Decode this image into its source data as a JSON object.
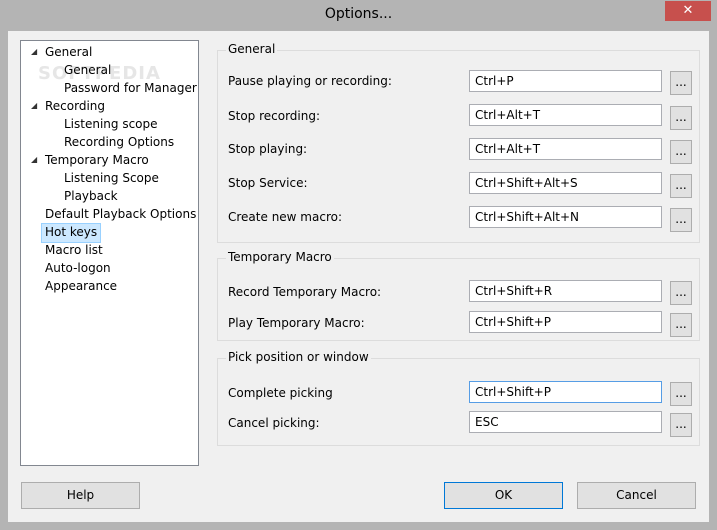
{
  "window": {
    "title": "Options...",
    "close_glyph": "✕"
  },
  "watermark": "SOFTPEDIA",
  "tree": {
    "items": [
      {
        "label": "General",
        "arrow": "◢"
      },
      {
        "label": "General"
      },
      {
        "label": "Password for Manager"
      },
      {
        "label": "Recording",
        "arrow": "◢"
      },
      {
        "label": "Listening scope"
      },
      {
        "label": "Recording Options"
      },
      {
        "label": "Temporary Macro",
        "arrow": "◢"
      },
      {
        "label": "Listening Scope"
      },
      {
        "label": "Playback"
      },
      {
        "label": "Default Playback Options"
      },
      {
        "label": "Hot keys",
        "selected": true
      },
      {
        "label": "Macro list"
      },
      {
        "label": "Auto-logon"
      },
      {
        "label": "Appearance"
      }
    ]
  },
  "groups": {
    "general": {
      "title": "General",
      "rows": [
        {
          "label": "Pause playing or recording:",
          "value": "Ctrl+P"
        },
        {
          "label": "Stop recording:",
          "value": "Ctrl+Alt+T"
        },
        {
          "label": "Stop playing:",
          "value": "Ctrl+Alt+T"
        },
        {
          "label": "Stop Service:",
          "value": "Ctrl+Shift+Alt+S"
        },
        {
          "label": "Create new macro:",
          "value": "Ctrl+Shift+Alt+N"
        }
      ]
    },
    "temporary": {
      "title": "Temporary Macro",
      "rows": [
        {
          "label": "Record Temporary Macro:",
          "value": "Ctrl+Shift+R"
        },
        {
          "label": "Play Temporary Macro:",
          "value": "Ctrl+Shift+P"
        }
      ]
    },
    "pick": {
      "title": "Pick position or window",
      "rows": [
        {
          "label": "Complete picking",
          "value": "Ctrl+Shift+P"
        },
        {
          "label": "Cancel picking:",
          "value": "ESC"
        }
      ]
    }
  },
  "browse_label": "...",
  "buttons": {
    "help": "Help",
    "ok": "OK",
    "cancel": "Cancel"
  },
  "colors": {
    "selection": "#cce8ff",
    "close_red": "#c7504d",
    "focus_border": "#0078d7"
  }
}
